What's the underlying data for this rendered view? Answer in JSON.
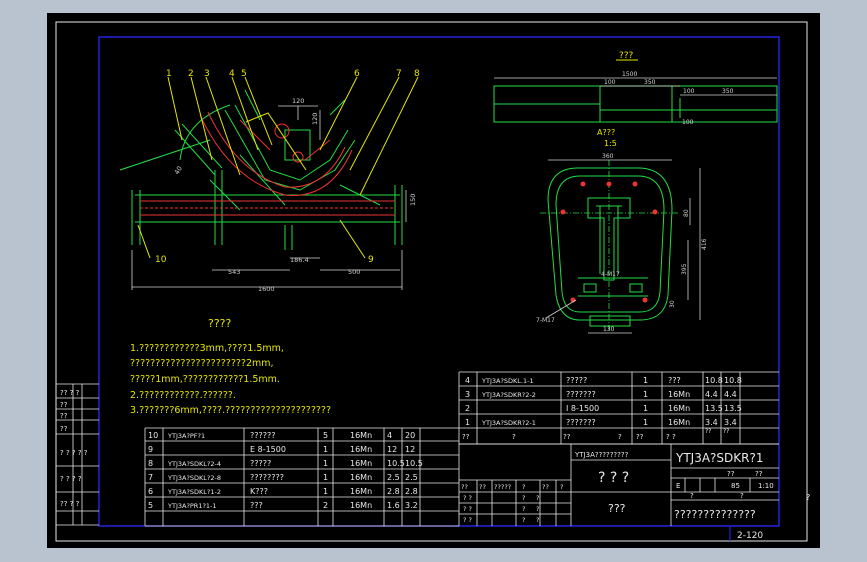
{
  "drawing": {
    "sheet_number": "2-120",
    "outside_marker": "?",
    "side_view": {
      "balloons": [
        "1",
        "2",
        "3",
        "4",
        "5",
        "6",
        "7",
        "8",
        "9",
        "10"
      ],
      "dimensions": {
        "d120": "120",
        "d120_vertical": "120",
        "d40": "40",
        "d543": "543",
        "d186": "186.4",
        "d500": "500",
        "d1600": "1600",
        "d150": "150"
      }
    },
    "top_view": {
      "title": "???",
      "dimensions": {
        "d1500": "1500",
        "d100a": "100",
        "d350a": "350",
        "d100b": "100",
        "d350b": "350",
        "d100c": "100"
      }
    },
    "section_view": {
      "title": "A???",
      "scale": "1:5",
      "label_i": "I",
      "dimensions": {
        "d360": "360",
        "d80": "80",
        "d416": "416",
        "d395": "395",
        "d30": "30",
        "d130": "130",
        "d4m17": "4-M17",
        "d7m17": "7-M17"
      }
    },
    "notes": {
      "title": "????",
      "lines": [
        "1.????????????3mm,????1.5mm,",
        "   ???????????????????????2mm,",
        "   ?????1mm,????????????1.5mm.",
        "2.????????????.??????.",
        "3.???????6mm,????.?????????????????????"
      ]
    },
    "left_strip": [
      "?? ? ?",
      "??",
      "??",
      "??",
      "? ? ? ? ?",
      "? ? ? ?",
      "?? ? ?"
    ],
    "bom_upper": [
      [
        "4",
        "YTJ3A?SDKL.1-1",
        "?????",
        "1",
        "???",
        "10.8",
        "10.8"
      ],
      [
        "3",
        "YTJ3A?SDKR?2-2",
        "???????",
        "1",
        "16Mn",
        "4.4",
        "4.4"
      ],
      [
        "2",
        "",
        "I 8-1500",
        "1",
        "16Mn",
        "13.5",
        "13.5"
      ],
      [
        "1",
        "YTJ3A?SDKR?2-1",
        "???????",
        "1",
        "16Mn",
        "3.4",
        "3.4"
      ]
    ],
    "bom_header": [
      "??",
      "?",
      "??",
      "?",
      "??",
      "? ?",
      ""
    ],
    "bom_header_sub": [
      "??",
      "??"
    ],
    "bom_lower": [
      [
        "10",
        "YTJ3A?PF?1",
        "??????",
        "5",
        "16Mn",
        "4",
        "20"
      ],
      [
        "9",
        "",
        "E 8-1500",
        "1",
        "16Mn",
        "12",
        "12"
      ],
      [
        "8",
        "YTJ3A?SDKL?2-4",
        "?????",
        "1",
        "16Mn",
        "10.5",
        "10.5"
      ],
      [
        "7",
        "YTJ3A?SDKL?2-8",
        "????????",
        "1",
        "16Mn",
        "2.5",
        "2.5"
      ],
      [
        "6",
        "YTJ3A?SDKL?1-2",
        "K???",
        "1",
        "16Mn",
        "2.8",
        "2.8"
      ],
      [
        "5",
        "YTJ3A?PR1?1-1",
        "???",
        "2",
        "16Mn",
        "1.6",
        "3.2"
      ]
    ],
    "title_block": {
      "code_label": "YTJ3A?????????",
      "drawing_code": "YTJ3A?SDKR?1",
      "name": "? ? ?",
      "sub_name": "???",
      "company": "??????????????",
      "stage": "E",
      "weight": "85",
      "scale": "1:10",
      "weight_label": "??",
      "scale_label": "??",
      "sheet_a": "?",
      "sheet_b": "?",
      "rev_cells": [
        "??",
        "??",
        "?????",
        "?",
        "??",
        "?",
        "?"
      ],
      "sign_rows": [
        [
          "? ?",
          "?",
          "?"
        ],
        [
          "? ?",
          "?",
          "?"
        ],
        [
          "? ?",
          "?",
          "?"
        ],
        [
          "? ?",
          "?",
          "?"
        ]
      ]
    }
  }
}
